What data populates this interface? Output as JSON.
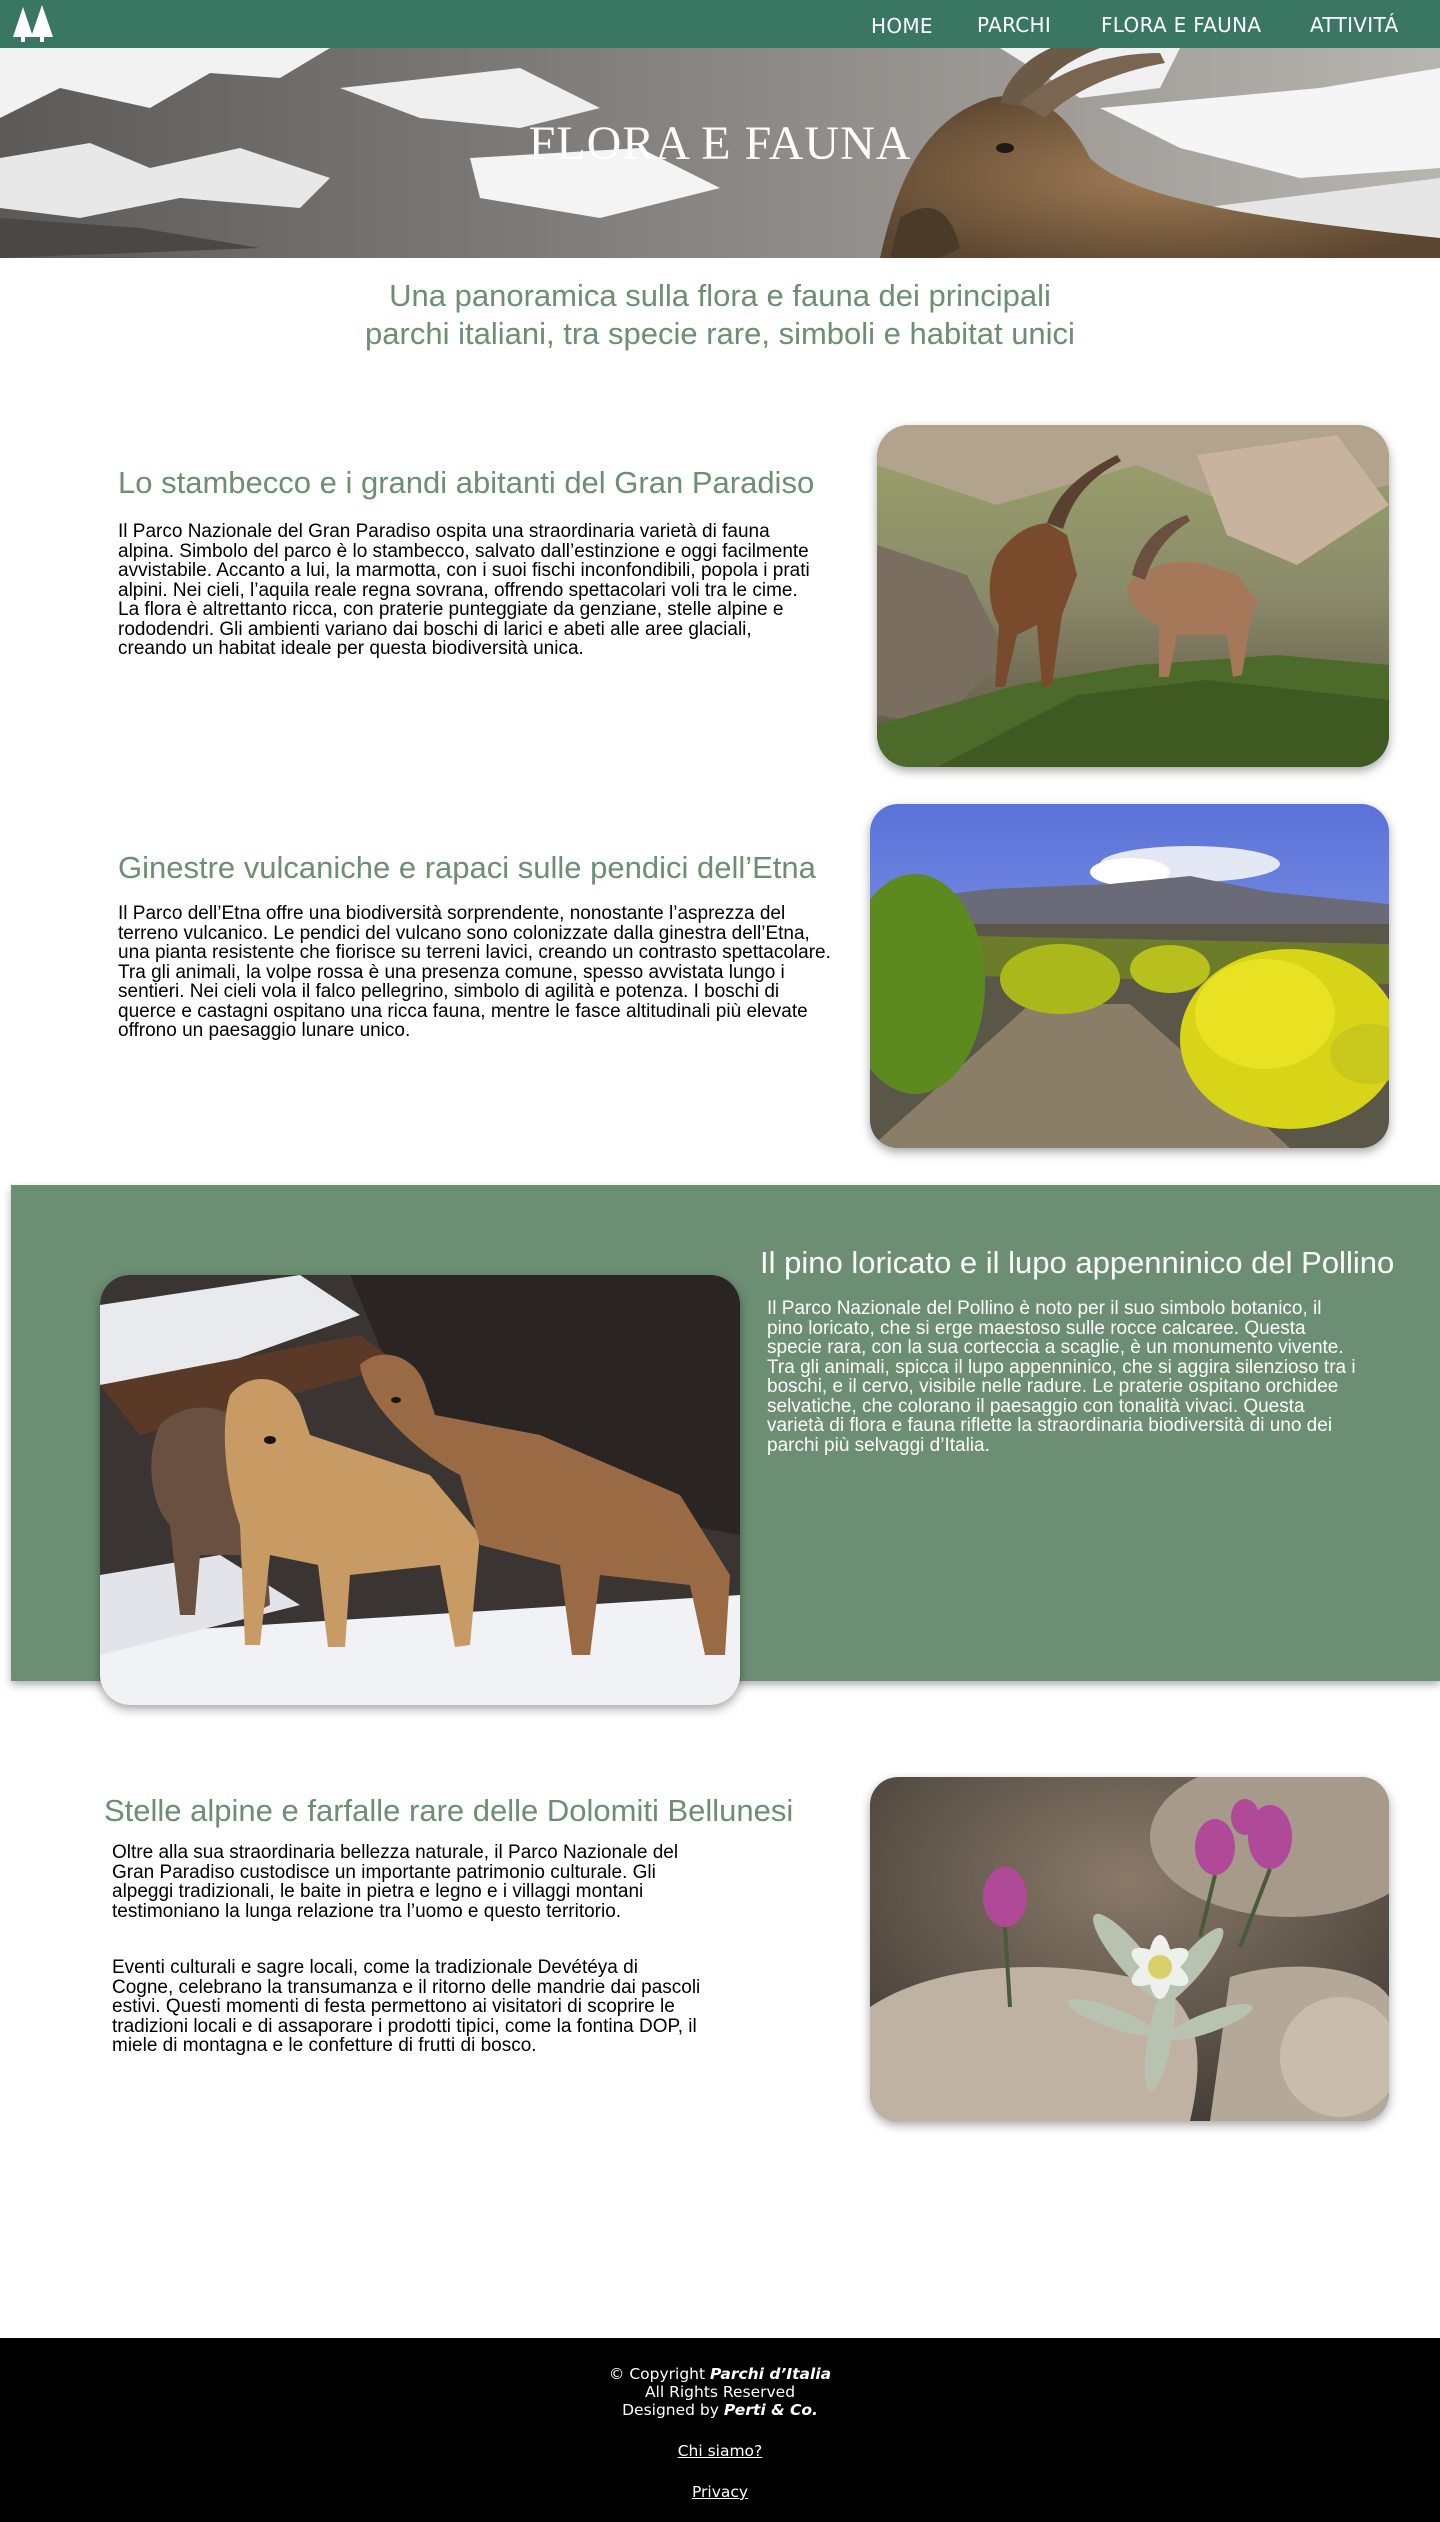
{
  "nav": {
    "logo_icon": "trees-logo-icon",
    "items": [
      {
        "label": "HOME"
      },
      {
        "label": "PARCHI"
      },
      {
        "label": "FLORA E FAUNA"
      },
      {
        "label": "ATTIVITÁ"
      }
    ]
  },
  "hero": {
    "title": "FLORA E FAUNA",
    "image": "ibex-on-snowy-mountains-photo"
  },
  "intro": {
    "line1": "Una panoramica sulla flora e fauna dei principali",
    "line2": "parchi italiani, tra specie rare, simboli e habitat unici"
  },
  "sections": [
    {
      "title": "Lo stambecco e i grandi abitanti del Gran Paradiso",
      "text": "Il Parco Nazionale del Gran Paradiso ospita una straordinaria varietà di fauna alpina. Simbolo del parco è lo stambecco, salvato dall’estinzione e oggi facilmente avvistabile. Accanto a lui, la marmotta, con i suoi fischi inconfondibili, popola i prati alpini. Nei cieli, l’aquila reale regna sovrana, offrendo spettacolari voli tra le cime. La flora è altrettanto ricca, con praterie punteggiate da genziane, stelle alpine e rododendri. Gli ambienti variano dai boschi di larici e abeti alle aree glaciali, creando un habitat ideale per questa biodiversità unica.",
      "image": "two-ibexes-on-grassy-slope-photo"
    },
    {
      "title": "Ginestre vulcaniche e rapaci sulle pendici dell’Etna",
      "text": "Il Parco dell’Etna offre una biodiversità sorprendente, nonostante l’asprezza del terreno vulcanico. Le pendici del vulcano sono colonizzate dalla ginestra dell’Etna, una pianta resistente che fiorisce su terreni lavici, creando un contrasto spettacolare. Tra gli animali, la volpe rossa è una presenza comune, spesso avvistata lungo i sentieri. Nei cieli vola il falco pellegrino, simbolo di agilità e potenza. I boschi di querce e castagni ospitano una ricca fauna, mentre le fasce altitudinali più elevate offrono un paesaggio lunare unico.",
      "image": "yellow-broom-bushes-etna-photo"
    },
    {
      "title": "Il pino loricato e il lupo appenninico del Pollino",
      "text": "Il Parco Nazionale del Pollino è noto per il suo simbolo botanico, il pino loricato, che si erge maestoso sulle rocce calcaree. Questa specie rara, con la sua corteccia a scaglie, è un monumento vivente. Tra gli animali, spicca il lupo appenninico, che si aggira silenzioso tra i boschi, e il cervo, visibile nelle radure. Le praterie ospitano orchidee selvatiche, che colorano il paesaggio con tonalità vivaci. Questa varietà di flora e fauna riflette la straordinaria biodiversità di uno dei parchi più selvaggi d’Italia.",
      "image": "wolves-in-snow-photo"
    },
    {
      "title": "Stelle alpine e farfalle rare delle Dolomiti Bellunesi",
      "text1": "Oltre alla sua straordinaria bellezza naturale, il Parco Nazionale del Gran Paradiso custodisce un importante patrimonio culturale. Gli alpeggi tradizionali, le baite in pietra e legno e i villaggi montani testimoniano la lunga relazione tra l’uomo e questo territorio.",
      "text2": "Eventi culturali e sagre locali, come la tradizionale Devétéya di Cogne, celebrano la transumanza e il ritorno delle mandrie dai pascoli estivi. Questi momenti di festa permettono ai visitatori di scoprire le tradizioni locali e di assaporare i prodotti tipici, come la fontina DOP, il miele di montagna e le confetture di frutti di bosco.",
      "image": "edelweiss-and-pink-flowers-photo"
    }
  ],
  "footer": {
    "copyright_prefix": "© Copyright ",
    "brand": "Parchi d’Italia",
    "rights": "All Rights Reserved",
    "designed_prefix": "Designed by ",
    "designer": "Perti & Co.",
    "link_about": "Chi siamo?",
    "link_privacy": "Privacy"
  },
  "colors": {
    "nav_bg": "#3a7762",
    "accent_green": "#6c8e72",
    "footer_bg": "#000000"
  }
}
